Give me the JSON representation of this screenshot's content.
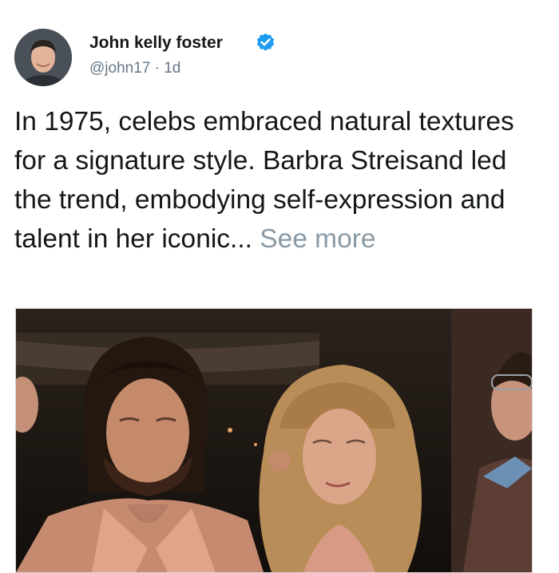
{
  "post": {
    "author_name": "John kelly foster",
    "handle": "@john17",
    "separator": "·",
    "time_ago": "1d",
    "verified": true,
    "text": "In 1975, celebs embraced natural textures for a signature style. Barbra Streisand led the trend, embodying self-expression and talent in her iconic...",
    "see_more_label": "See more"
  },
  "icons": {
    "verified": "verified-badge-icon",
    "avatar": "avatar"
  },
  "colors": {
    "verified_blue": "#1d9bf0",
    "secondary_text": "#657786",
    "see_more": "#8899a6",
    "primary_text": "#14171a"
  }
}
